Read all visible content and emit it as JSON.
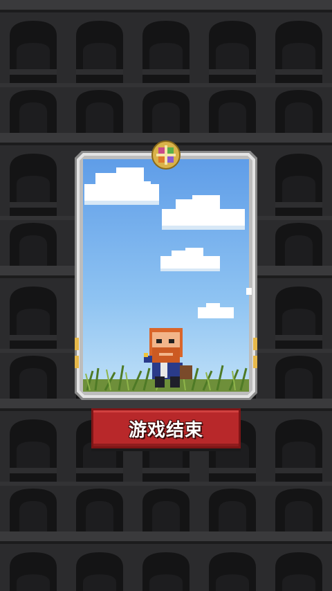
{
  "screen": {
    "end_button_label": "游戏结束"
  },
  "icons": [
    "tower-wall-background",
    "colorful-gem-icon",
    "bearded-hero-character"
  ],
  "colors": {
    "background_wall": "#2b2b2d",
    "button_red": "#b8282a",
    "sky_top": "#5f9de8",
    "sky_bottom": "#bfe0f7",
    "card_frame": "#d8d8d8"
  }
}
